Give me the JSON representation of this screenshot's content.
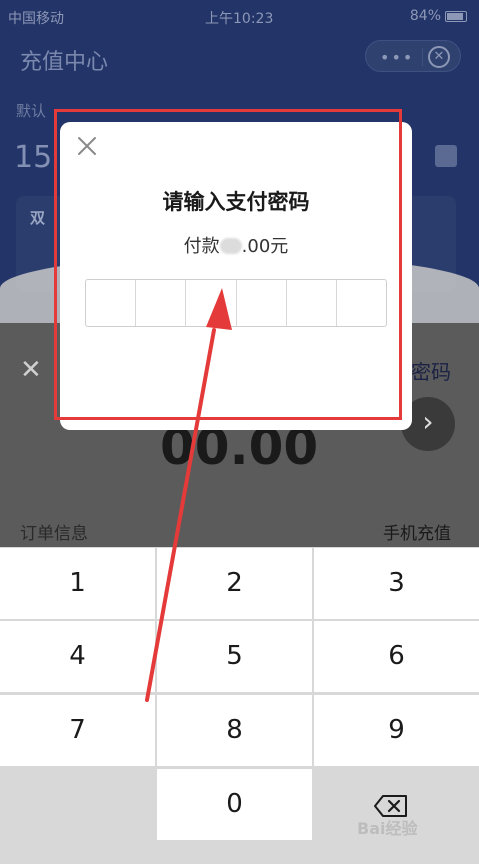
{
  "status_bar": {
    "carrier": "中国移动",
    "time": "上午10:23",
    "battery": "84%"
  },
  "background": {
    "nav_title": "充值中心",
    "subtitle": "默认",
    "phone_prefix": "15",
    "card_label": "双",
    "sheet_right_label": "密码",
    "amount": "00.00",
    "order_label": "订单信息",
    "order_value": "手机充值"
  },
  "modal": {
    "title": "请输入支付密码",
    "amount_prefix": "付款",
    "amount_suffix": ".00元",
    "password_length": 6
  },
  "keypad": {
    "keys": [
      "1",
      "2",
      "3",
      "4",
      "5",
      "6",
      "7",
      "8",
      "9",
      "0"
    ]
  },
  "watermark": "Bai经验",
  "colors": {
    "annotation": "#e43a3a",
    "dim_background": "#223468"
  }
}
